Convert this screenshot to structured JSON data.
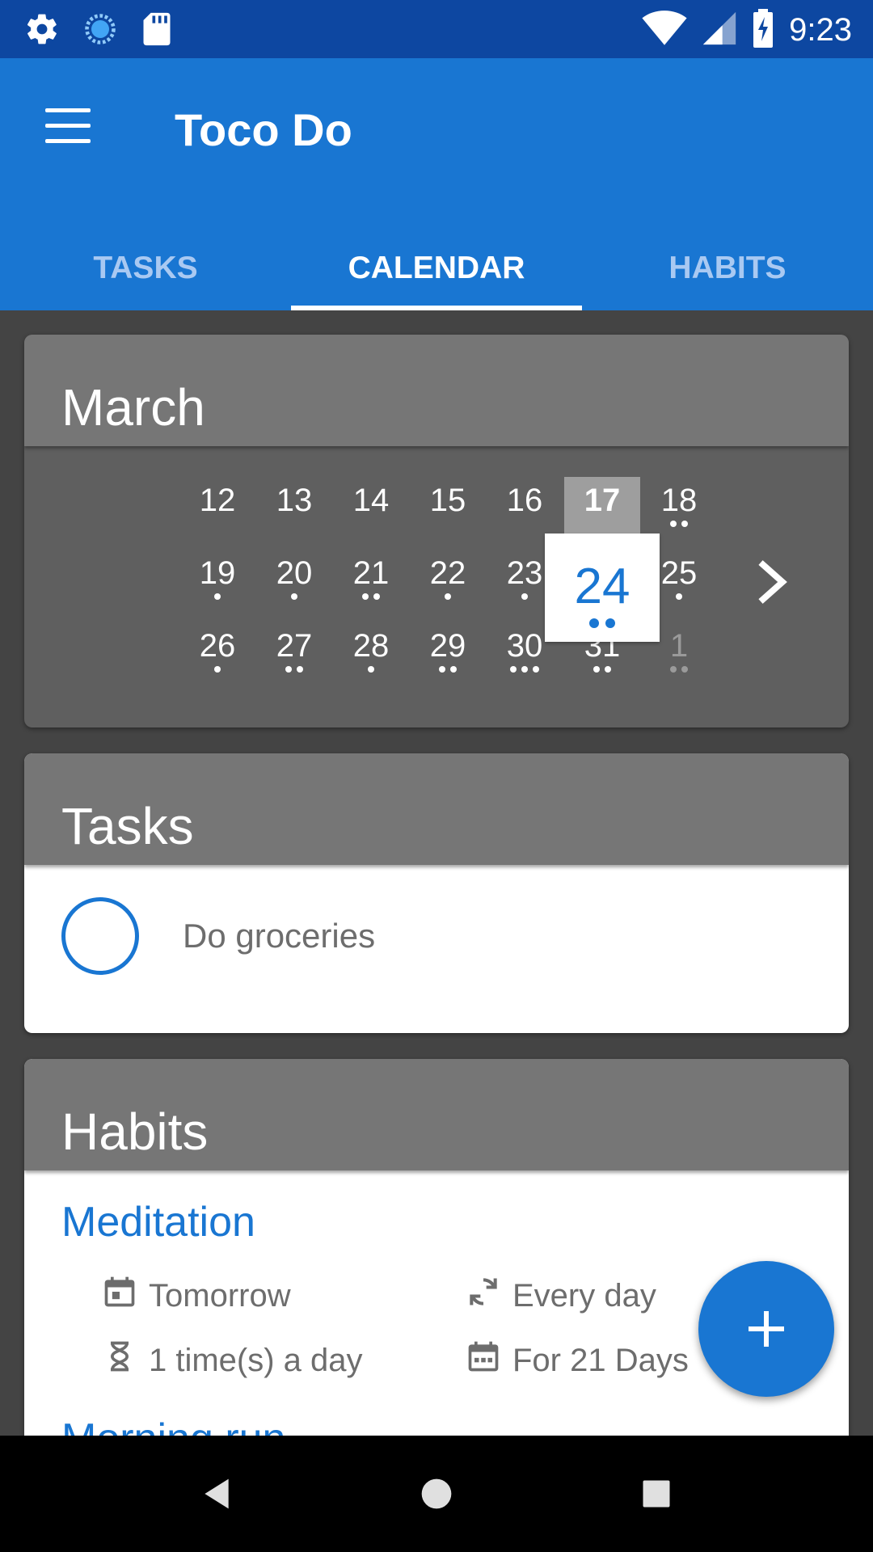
{
  "status_bar": {
    "time": "9:23",
    "left_icons": [
      "settings-icon",
      "sync-icon",
      "sd-card-icon"
    ],
    "right_icons": [
      "wifi-icon",
      "signal-icon",
      "battery-charging-icon"
    ]
  },
  "app_bar": {
    "title": "Toco Do",
    "menu_icon": "menu-icon"
  },
  "tabs": [
    {
      "label": "TASKS",
      "active": false
    },
    {
      "label": "CALENDAR",
      "active": true
    },
    {
      "label": "HABITS",
      "active": false
    }
  ],
  "calendar": {
    "month": "March",
    "today": "17",
    "selected": "24",
    "selected_dots": 2,
    "weeks": [
      [
        {
          "d": "12",
          "dots": 0
        },
        {
          "d": "13",
          "dots": 0
        },
        {
          "d": "14",
          "dots": 0
        },
        {
          "d": "15",
          "dots": 0
        },
        {
          "d": "16",
          "dots": 0
        },
        {
          "d": "17",
          "dots": 0
        },
        {
          "d": "18",
          "dots": 2
        }
      ],
      [
        {
          "d": "19",
          "dots": 1
        },
        {
          "d": "20",
          "dots": 1
        },
        {
          "d": "21",
          "dots": 2
        },
        {
          "d": "22",
          "dots": 1
        },
        {
          "d": "23",
          "dots": 1
        },
        {
          "d": "24",
          "dots": 2
        },
        {
          "d": "25",
          "dots": 1
        }
      ],
      [
        {
          "d": "26",
          "dots": 1
        },
        {
          "d": "27",
          "dots": 2
        },
        {
          "d": "28",
          "dots": 1
        },
        {
          "d": "29",
          "dots": 2
        },
        {
          "d": "30",
          "dots": 3
        },
        {
          "d": "31",
          "dots": 2
        },
        {
          "d": "1",
          "dots": 2,
          "muted": true
        }
      ]
    ],
    "next_icon": "chevron-right-icon"
  },
  "tasks": {
    "header": "Tasks",
    "items": [
      {
        "label": "Do groceries",
        "done": false
      }
    ]
  },
  "habits": {
    "header": "Habits",
    "items": [
      {
        "name": "Meditation",
        "when": "Tomorrow",
        "repeat": "Every day",
        "frequency": "1 time(s) a day",
        "duration": "For 21 Days"
      }
    ],
    "next_partial": "Morning run"
  },
  "fab": {
    "icon": "plus-icon"
  },
  "colors": {
    "primary": "#1976d2",
    "primary_dark": "#0d47a1",
    "card_header": "#767676"
  }
}
